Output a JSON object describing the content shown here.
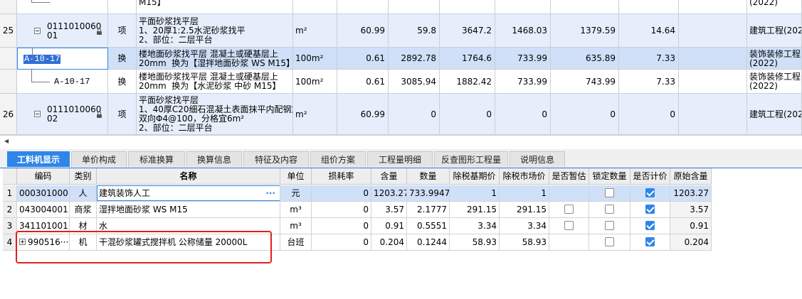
{
  "top_rows": [
    {
      "row_no": "",
      "code": "",
      "type": "",
      "name": "M15】",
      "unit": "",
      "quantity": "",
      "comprehensive_price": "",
      "total": "",
      "labor": "",
      "material": "",
      "machine": "",
      "specialty": "(2022)",
      "style": "white"
    },
    {
      "row_no": "25",
      "code": "0111010060\n01",
      "type": "项",
      "name": "平面砂浆找平层\n1、20厚1:2.5水泥砂浆找平\n2、部位：二层平台",
      "unit": "m²",
      "quantity": "60.99",
      "comprehensive_price": "59.8",
      "total": "3647.2",
      "labor": "1468.03",
      "material": "1379.59",
      "machine": "14.64",
      "specialty": "建筑工程(2022",
      "style": "blue"
    },
    {
      "row_no": "",
      "code": "A-10-17",
      "type": "换",
      "name": "楼地面砂浆找平层 混凝土或硬基层上\n20mm  换为【湿拌地面砂浆 WS M15】",
      "unit": "100m²",
      "quantity": "0.61",
      "comprehensive_price": "2892.78",
      "total": "1764.6",
      "labor": "733.99",
      "material": "635.89",
      "machine": "7.33",
      "specialty": "装饰装修工程\n(2022)",
      "style": "sel"
    },
    {
      "row_no": "",
      "code": "A-10-17",
      "type": "换",
      "name": "楼地面砂浆找平层 混凝土或硬基层上\n20mm  换为【水泥砂浆 中砂 M15】",
      "unit": "100m²",
      "quantity": "0.61",
      "comprehensive_price": "3085.94",
      "total": "1882.42",
      "labor": "733.99",
      "material": "743.99",
      "machine": "7.33",
      "specialty": "装饰装修工程\n(2022)",
      "style": "white"
    },
    {
      "row_no": "26",
      "code": "0111010060\n02",
      "type": "项",
      "name": "平面砂浆找平层\n1、40厚C20细石混凝土表面抹平内配钢筋\n双向Φ4@100，分格宜6m²\n2、部位：二层平台",
      "unit": "m²",
      "quantity": "60.99",
      "comprehensive_price": "0",
      "total": "0",
      "labor": "0",
      "material": "0",
      "machine": "0",
      "specialty": "建筑工程(2022",
      "style": "blue"
    }
  ],
  "tabs": [
    {
      "label": "工料机显示",
      "active": true
    },
    {
      "label": "单价构成",
      "active": false
    },
    {
      "label": "标准换算",
      "active": false
    },
    {
      "label": "换算信息",
      "active": false
    },
    {
      "label": "特征及内容",
      "active": false
    },
    {
      "label": "组价方案",
      "active": false
    },
    {
      "label": "工程量明细",
      "active": false
    },
    {
      "label": "反查图形工程量",
      "active": false
    },
    {
      "label": "说明信息",
      "active": false
    }
  ],
  "resource_table": {
    "headers": [
      "编码",
      "类别",
      "名称",
      "单位",
      "损耗率",
      "含量",
      "数量",
      "除税基期价",
      "除税市场价",
      "是否暂估",
      "锁定数量",
      "是否计价",
      "原始含量"
    ],
    "rows": [
      {
        "idx": "1",
        "code": "000301000",
        "category": "人",
        "name": "建筑装饰人工",
        "name_suffix": "···",
        "unit": "元",
        "loss_rate": "0",
        "content": "1203.27",
        "quantity": "733.9947",
        "base_price": "1",
        "market_price": "1",
        "provisional": null,
        "lock_qty": false,
        "priced": true,
        "original_content": "1203.27",
        "selected": true
      },
      {
        "idx": "2",
        "code": "043004001",
        "category": "商浆",
        "name": "湿拌地面砂浆 WS M15",
        "name_suffix": "",
        "unit": "m³",
        "loss_rate": "0",
        "content": "3.57",
        "quantity": "2.1777",
        "base_price": "291.15",
        "market_price": "291.15",
        "provisional": false,
        "lock_qty": false,
        "priced": true,
        "original_content": "3.57",
        "selected": false
      },
      {
        "idx": "3",
        "code": "341101001",
        "category": "材",
        "name": "水",
        "name_suffix": "",
        "unit": "m³",
        "loss_rate": "0",
        "content": "0.91",
        "quantity": "0.5551",
        "base_price": "3.34",
        "market_price": "3.34",
        "provisional": false,
        "lock_qty": false,
        "priced": true,
        "original_content": "0.91",
        "selected": false
      },
      {
        "idx": "4",
        "code": "990516···",
        "category": "机",
        "name": "干混砂浆罐式搅拌机 公称储量 20000L",
        "name_suffix": "",
        "unit": "台班",
        "loss_rate": "0",
        "content": "0.204",
        "quantity": "0.1244",
        "base_price": "58.93",
        "market_price": "58.93",
        "provisional": null,
        "lock_qty": false,
        "priced": true,
        "original_content": "0.204",
        "selected": false
      }
    ]
  },
  "colors": {
    "accent": "#2f86e8",
    "selected_row": "#cfe0f8",
    "item_row": "#e6eefb",
    "annotation": "#e02020"
  }
}
